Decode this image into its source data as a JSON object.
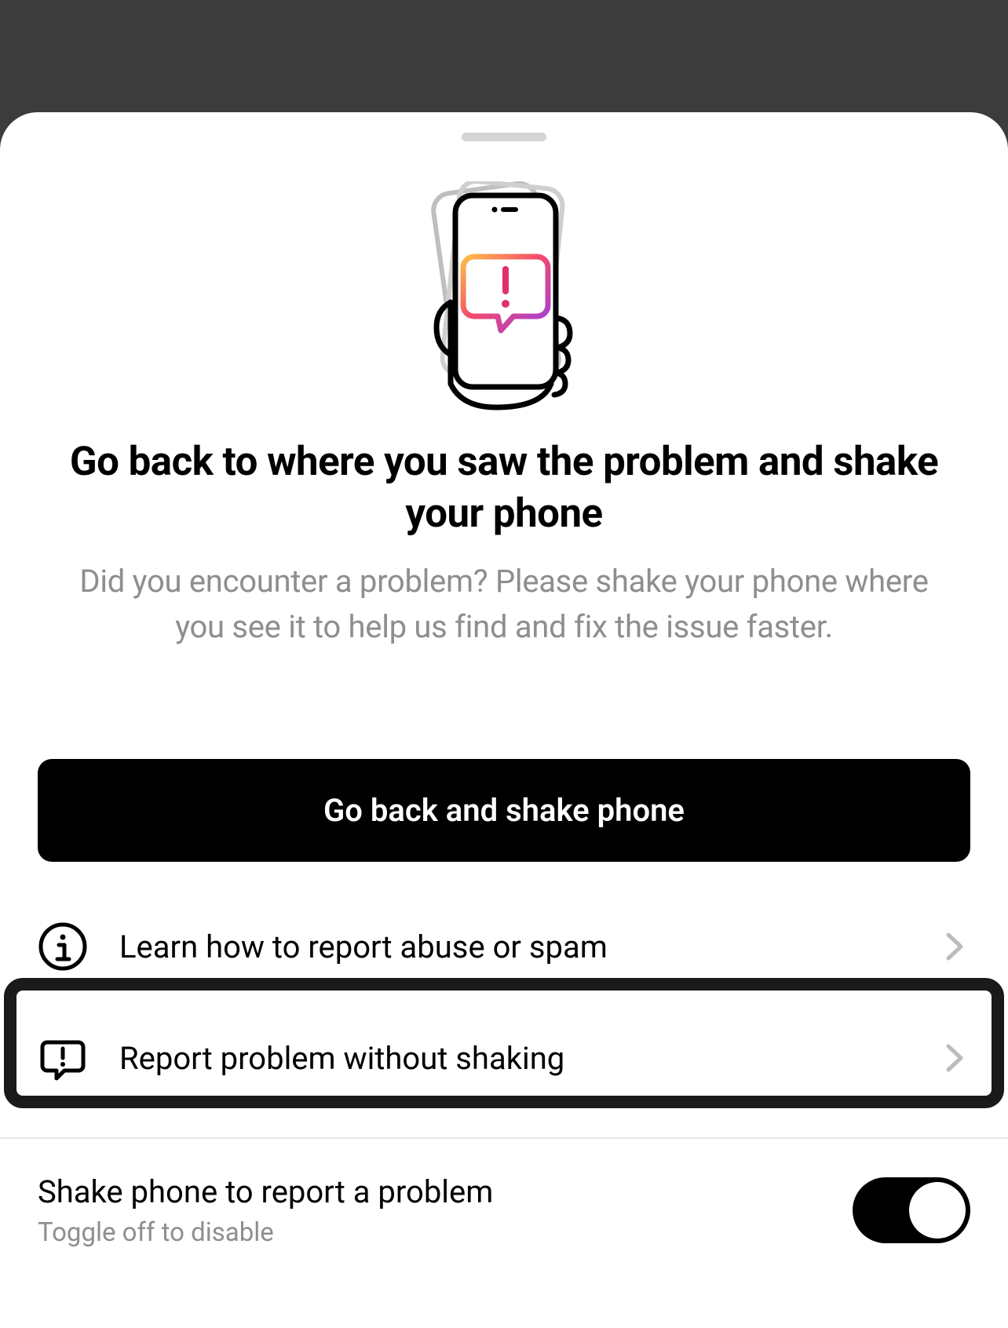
{
  "illustration": {
    "name": "shake-phone-illustration"
  },
  "heading": "Go back to where you saw the problem and shake your phone",
  "description": "Did you encounter a problem? Please shake your phone where you see it to help us find and fix the issue faster.",
  "primary_button": "Go back and shake phone",
  "rows": [
    {
      "icon": "info-icon",
      "label": "Learn how to report abuse or spam"
    },
    {
      "icon": "report-icon",
      "label": "Report problem without shaking",
      "highlighted": true
    }
  ],
  "toggle": {
    "title": "Shake phone to report a problem",
    "subtitle": "Toggle off to disable",
    "on": true
  }
}
